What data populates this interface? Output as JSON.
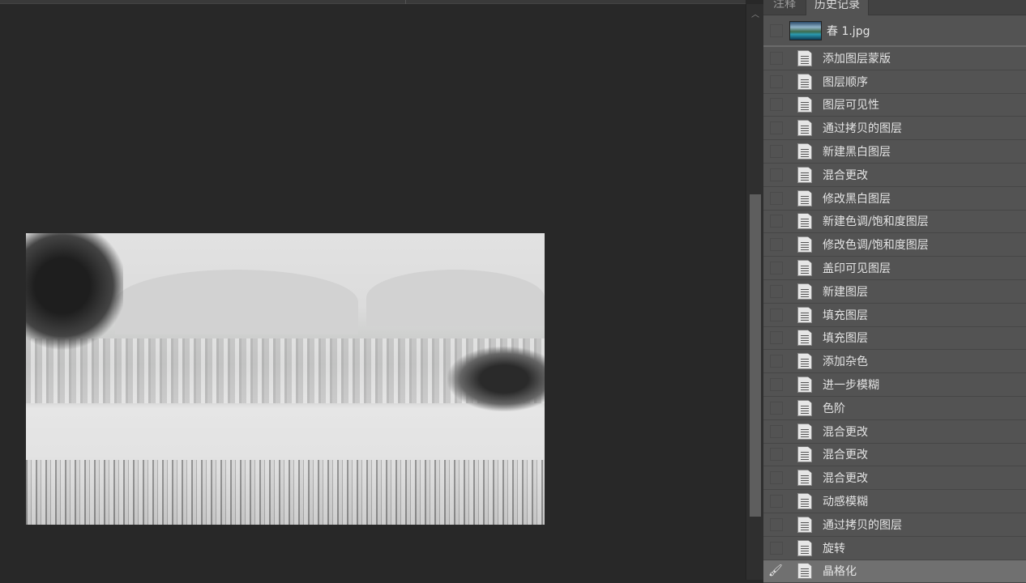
{
  "panel": {
    "tabs": [
      {
        "label": "注释"
      },
      {
        "label": "历史记录"
      }
    ],
    "snapshot": {
      "label": "春 1.jpg"
    },
    "history": [
      {
        "label": "添加图层蒙版"
      },
      {
        "label": "图层顺序"
      },
      {
        "label": "图层可见性"
      },
      {
        "label": "通过拷贝的图层"
      },
      {
        "label": "新建黑白图层"
      },
      {
        "label": "混合更改"
      },
      {
        "label": "修改黑白图层"
      },
      {
        "label": "新建色调/饱和度图层"
      },
      {
        "label": "修改色调/饱和度图层"
      },
      {
        "label": "盖印可见图层"
      },
      {
        "label": "新建图层"
      },
      {
        "label": "填充图层"
      },
      {
        "label": "填充图层"
      },
      {
        "label": "添加杂色"
      },
      {
        "label": "进一步模糊"
      },
      {
        "label": "色阶"
      },
      {
        "label": "混合更改"
      },
      {
        "label": "混合更改"
      },
      {
        "label": "混合更改"
      },
      {
        "label": "动感模糊"
      },
      {
        "label": "通过拷贝的图层"
      },
      {
        "label": "旋转"
      },
      {
        "label": "晶格化",
        "selected": true
      }
    ]
  }
}
